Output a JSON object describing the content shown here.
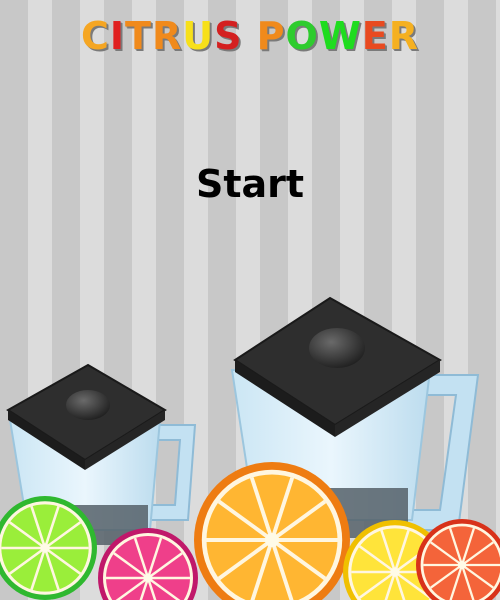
{
  "title": {
    "letters": [
      {
        "ch": "C",
        "color": "#f5a623"
      },
      {
        "ch": "I",
        "color": "#e02020"
      },
      {
        "ch": "T",
        "color": "#f08a1c"
      },
      {
        "ch": "R",
        "color": "#f08a1c"
      },
      {
        "ch": "U",
        "color": "#f7e01a"
      },
      {
        "ch": "S",
        "color": "#d42020"
      },
      {
        "ch": " ",
        "color": "#000000"
      },
      {
        "ch": "P",
        "color": "#f08a1c"
      },
      {
        "ch": "O",
        "color": "#2ecc2e"
      },
      {
        "ch": "W",
        "color": "#1fdc1f"
      },
      {
        "ch": "E",
        "color": "#e84a20"
      },
      {
        "ch": "R",
        "color": "#f5b020"
      }
    ]
  },
  "menu": {
    "start_label": "Start"
  },
  "colors": {
    "stripe_dark": "#c8c8c8",
    "stripe_light": "#dcdcdc",
    "lid": "#3a3a3a",
    "jar": "#cfe8f5"
  },
  "fruits": [
    {
      "name": "lime-slice",
      "rind": "#2fb82f",
      "flesh": "#9aee3a"
    },
    {
      "name": "grapefruit-slice",
      "rind": "#c0186a",
      "flesh": "#ef3f8a"
    },
    {
      "name": "orange-slice",
      "rind": "#ee7c12",
      "flesh": "#ffb632"
    },
    {
      "name": "lemon-slice",
      "rind": "#f0c000",
      "flesh": "#ffe43a"
    },
    {
      "name": "blood-orange-slice",
      "rind": "#d8321a",
      "flesh": "#f4643a"
    }
  ]
}
